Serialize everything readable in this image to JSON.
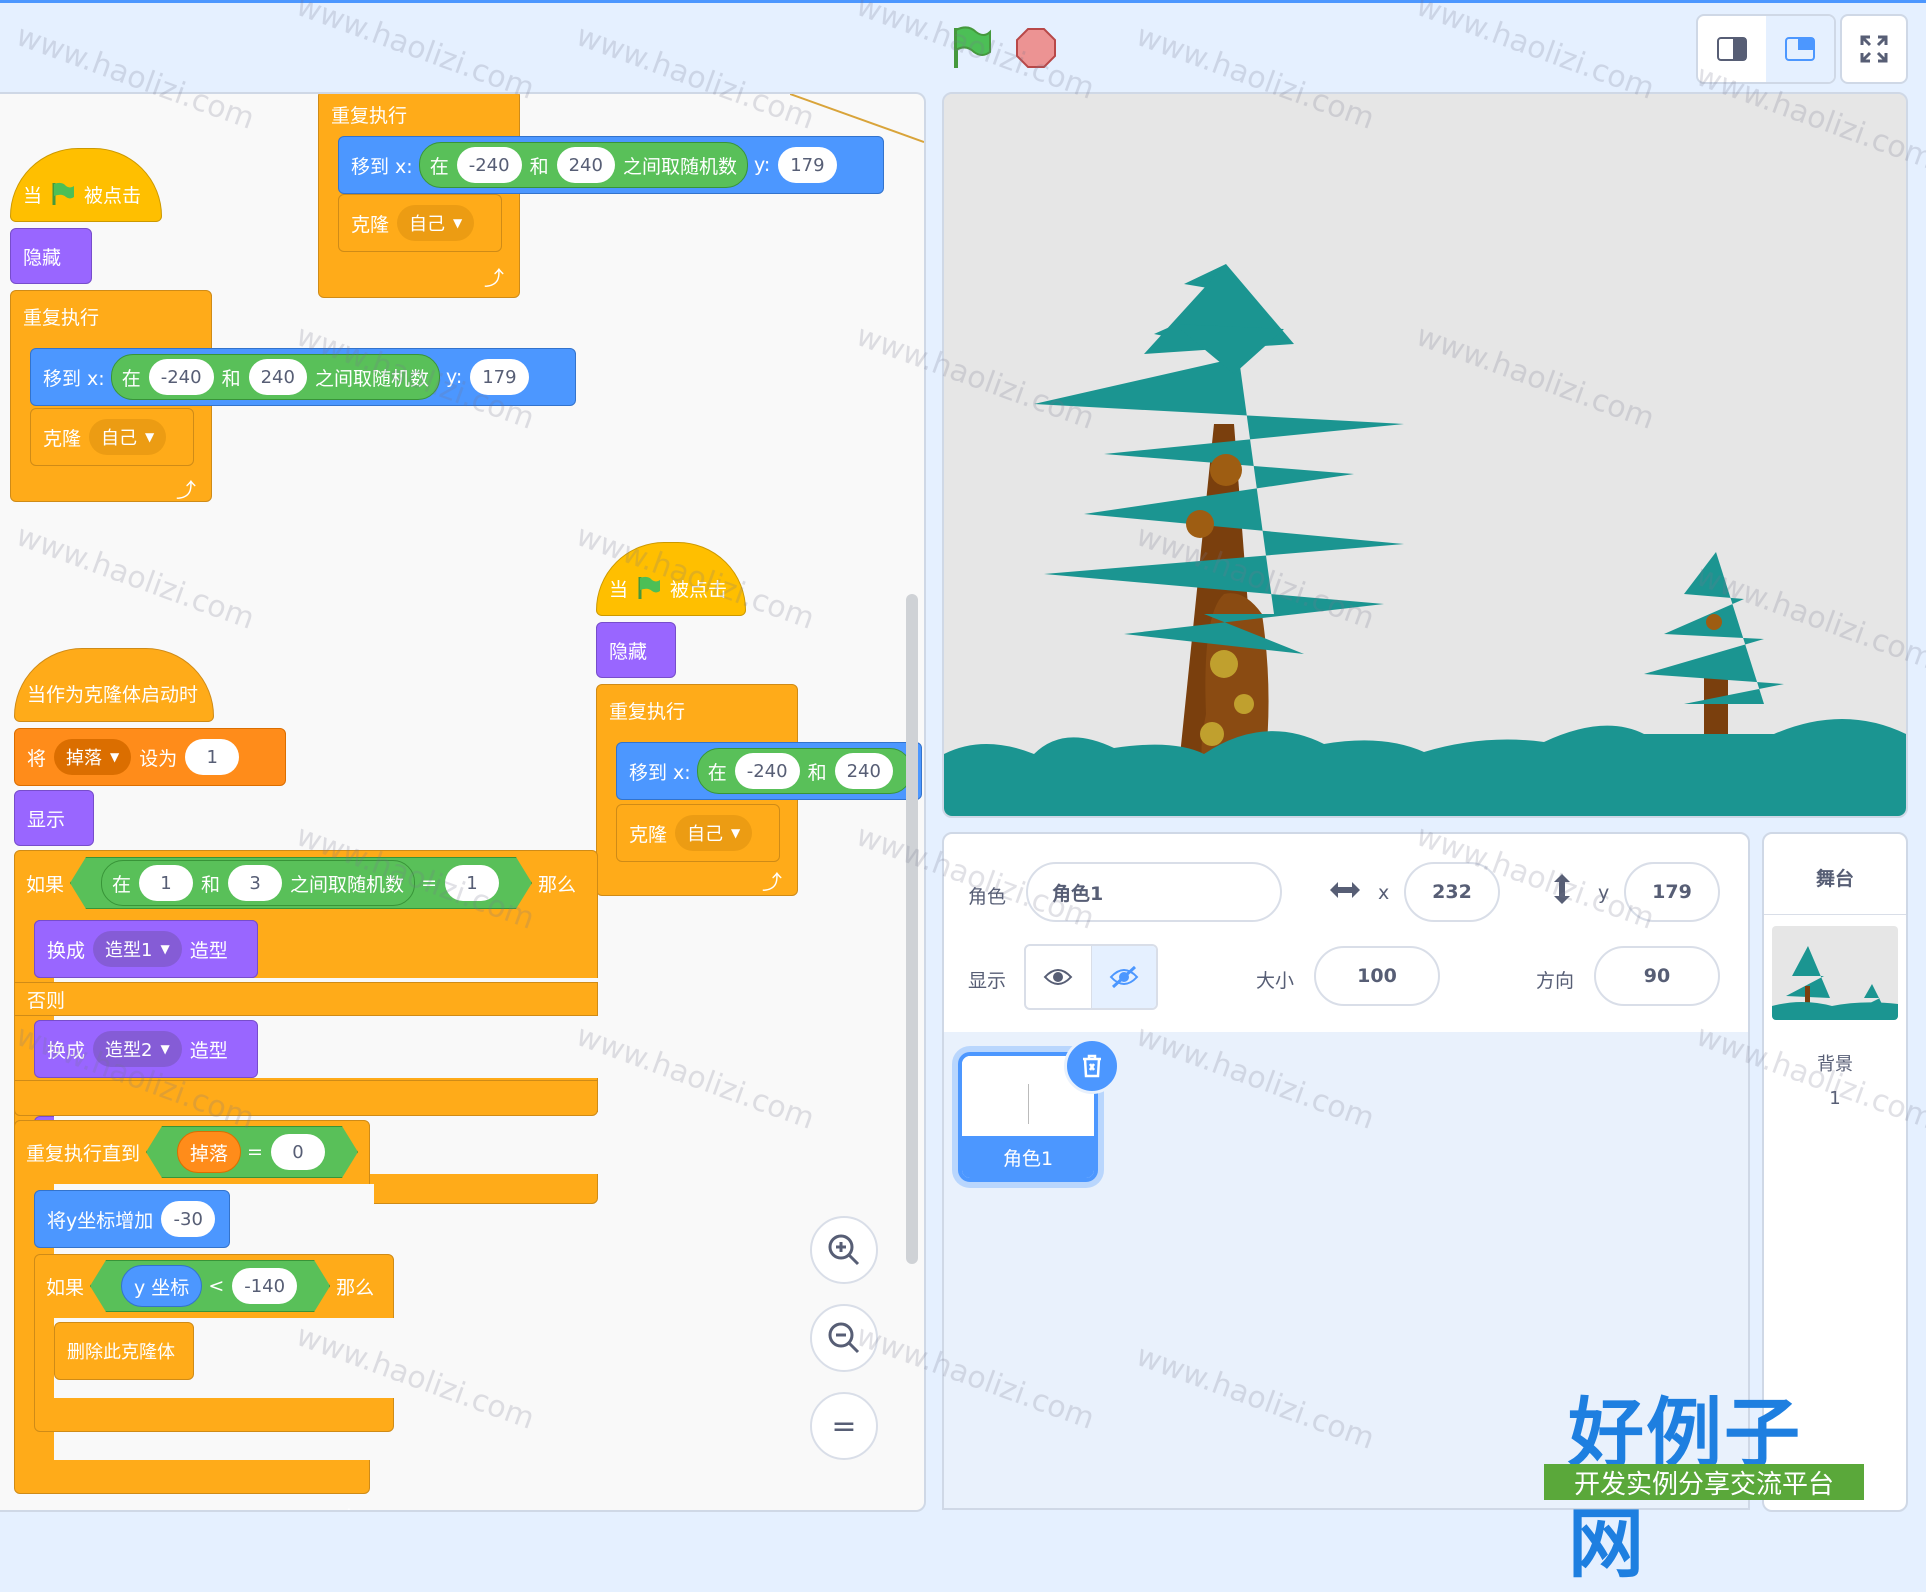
{
  "topbar": {
    "flag": "green-flag-icon",
    "stop": "stop-icon",
    "modes": [
      "small-stage-mode-icon",
      "normal-stage-mode-icon"
    ],
    "fullscreen": "fullscreen-icon"
  },
  "blocks": {
    "when_flag_clicked": [
      "当",
      "被点击"
    ],
    "hide": "隐藏",
    "show": "显示",
    "forever": "重复执行",
    "goto_x": "移到 x:",
    "y": "y:",
    "rand_in": "在",
    "rand_and": "和",
    "rand_between": "之间取随机数",
    "rand_min": "-240",
    "rand_max": "240",
    "y_value": "179",
    "clone": "克隆",
    "clone_target": "自己",
    "when_clone_start": "当作为克隆体启动时",
    "set": "将",
    "set_to": "设为",
    "var_fall": "掉落",
    "set_value": "1",
    "if": "如果",
    "then": "那么",
    "else": "否则",
    "rand2_min": "1",
    "rand2_max": "3",
    "equals": "=",
    "eq_value": "1",
    "switch_costume": "换成",
    "costume_suffix": "造型",
    "costume1": "造型1",
    "costume2": "造型2",
    "repeat_until": "重复执行直到",
    "zero": "0",
    "change_y": "将y坐标增加",
    "change_y_value": "-30",
    "y_position": "y 坐标",
    "less_than": "<",
    "lt_value": "-140",
    "delete_clone": "删除此克隆体"
  },
  "zoom": {
    "in": "zoom-in-icon",
    "out": "zoom-out-icon",
    "reset": "="
  },
  "sprite_info": {
    "sprite_label": "角色",
    "sprite_name": "角色1",
    "x_label": "x",
    "x_value": "232",
    "y_label": "y",
    "y_value": "179",
    "show_label": "显示",
    "size_label": "大小",
    "size_value": "100",
    "direction_label": "方向",
    "direction_value": "90"
  },
  "sprite_list": [
    {
      "name": "角色1",
      "selected": true
    }
  ],
  "stage_panel": {
    "title": "舞台",
    "backdrop_label": "背景",
    "backdrop_count": "1"
  },
  "watermark": "www.haolizi.com",
  "brand": {
    "title": "好例子网",
    "subtitle": "开发实例分享交流平台"
  }
}
